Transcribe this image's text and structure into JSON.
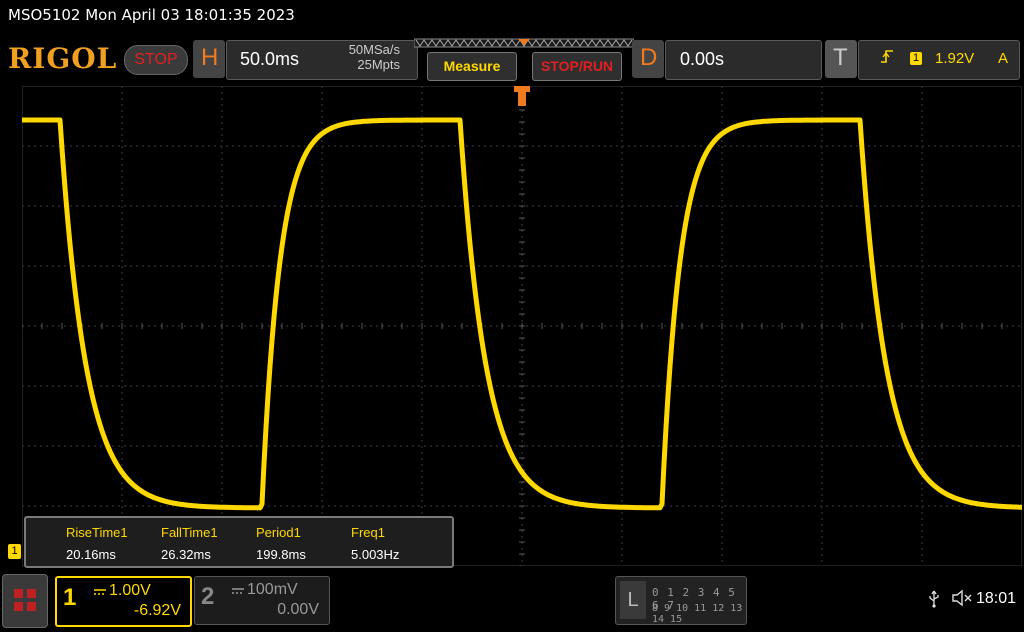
{
  "title_bar": {
    "text": "MSO5102  Mon April 03 18:01:35 2023"
  },
  "brand": {
    "logo": "RIGOL",
    "run_state": "STOP"
  },
  "horizontal": {
    "letter": "H",
    "timebase": "50.0ms",
    "sample_rate": "50MSa/s",
    "memory_depth": "25Mpts"
  },
  "buttons": {
    "measure": "Measure",
    "stop_run": "STOP/RUN"
  },
  "delay": {
    "letter": "D",
    "value": "0.00s"
  },
  "trigger": {
    "letter": "T",
    "edge_icon": "rising-edge-icon",
    "source": "1",
    "level": "1.92V",
    "mode": "A"
  },
  "colors": {
    "ch1": "#ffd800",
    "accent": "#f07a20",
    "grid": "#3c3c3c",
    "stop": "#e02020"
  },
  "measurements": {
    "headers": [
      "RiseTime1",
      "FallTime1",
      "Period1",
      "Freq1"
    ],
    "values": [
      "20.16ms",
      "26.32ms",
      "199.8ms",
      "5.003Hz"
    ]
  },
  "ch1_marker": "1",
  "channels": [
    {
      "num": "1",
      "scale": "1.00V",
      "offset": "-6.92V",
      "active": true
    },
    {
      "num": "2",
      "scale": "100mV",
      "offset": "0.00V",
      "active": false
    }
  ],
  "logic": {
    "letter": "L",
    "row1": "0 1 2 3  4 5 6 7",
    "row2": "8 9 10 11 12 13 14 15"
  },
  "status": {
    "usb_icon": "usb-icon",
    "speaker_icon": "speaker-muted-icon",
    "time": "18:01"
  }
}
